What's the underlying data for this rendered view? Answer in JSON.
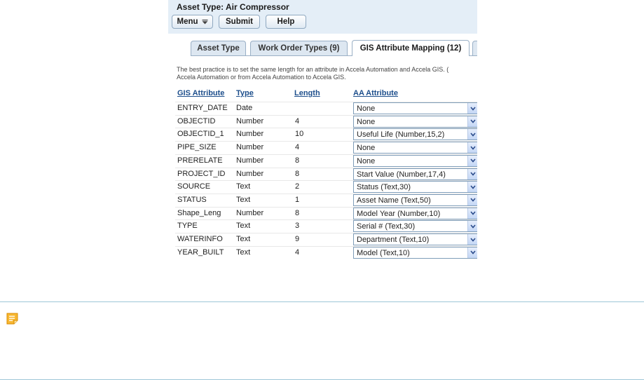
{
  "header": {
    "title": "Asset Type: Air Compressor",
    "menu_label": "Menu",
    "submit_label": "Submit",
    "help_label": "Help"
  },
  "tabs": [
    {
      "label": "Asset Type"
    },
    {
      "label": "Work Order Types (9)"
    },
    {
      "label": "GIS Attribute Mapping (12)",
      "active": true
    }
  ],
  "intro": {
    "line1": "The best practice is to set the same length for an attribute in Accela Automation and Accela GIS. (",
    "line2": "Accela Automation or from Accela Automation to Accela GIS."
  },
  "table": {
    "headers": {
      "gis": "GIS Attribute",
      "type": "Type",
      "length": "Length",
      "aa": "AA Attribute"
    },
    "rows": [
      {
        "gis": "ENTRY_DATE",
        "type": "Date",
        "length": "",
        "aa": "None"
      },
      {
        "gis": "OBJECTID",
        "type": "Number",
        "length": "4",
        "aa": "None"
      },
      {
        "gis": "OBJECTID_1",
        "type": "Number",
        "length": "10",
        "aa": "Useful Life (Number,15,2)"
      },
      {
        "gis": "PIPE_SIZE",
        "type": "Number",
        "length": "4",
        "aa": "None"
      },
      {
        "gis": "PRERELATE",
        "type": "Number",
        "length": "8",
        "aa": "None"
      },
      {
        "gis": "PROJECT_ID",
        "type": "Number",
        "length": "8",
        "aa": "Start Value (Number,17,4)"
      },
      {
        "gis": "SOURCE",
        "type": "Text",
        "length": "2",
        "aa": "Status (Text,30)"
      },
      {
        "gis": "STATUS",
        "type": "Text",
        "length": "1",
        "aa": "Asset Name (Text,50)"
      },
      {
        "gis": "Shape_Leng",
        "type": "Number",
        "length": "8",
        "aa": "Model Year (Number,10)"
      },
      {
        "gis": "TYPE",
        "type": "Text",
        "length": "3",
        "aa": "Serial # (Text,30)"
      },
      {
        "gis": "WATERINFO",
        "type": "Text",
        "length": "9",
        "aa": "Department (Text,10)"
      },
      {
        "gis": "YEAR_BUILT",
        "type": "Text",
        "length": "4",
        "aa": "Model (Text,10)"
      }
    ]
  },
  "icons": {
    "note": "note-icon",
    "dropdown": "chevron-down-icon"
  },
  "colors": {
    "header_bg": "#e4eef7",
    "link": "#1e4f8c",
    "rule": "#9ec7d8",
    "note_icon": "#f2a516"
  }
}
